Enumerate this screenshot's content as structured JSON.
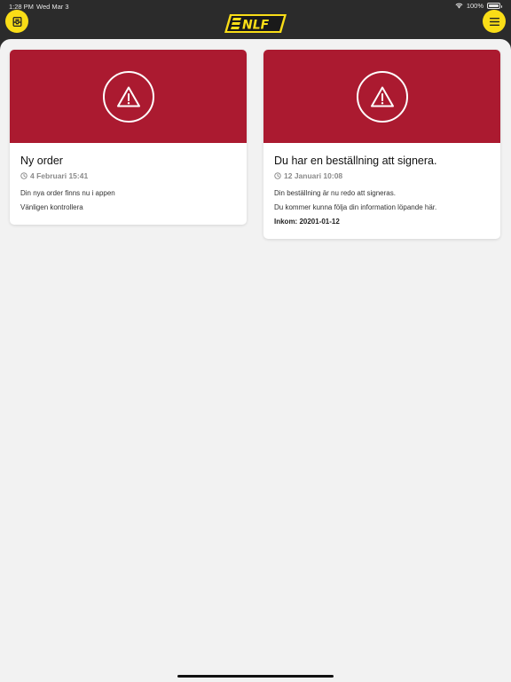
{
  "status_bar": {
    "time": "1:28 PM",
    "date": "Wed Mar 3",
    "battery": "100%"
  },
  "header": {
    "logo_text": "NLF",
    "left_icon": "inbox-icon",
    "right_icon": "menu-icon",
    "accent_color": "#f9dd17"
  },
  "notifications": [
    {
      "icon": "alert-triangle-icon",
      "banner_color": "#ab1a30",
      "title": "Ny order",
      "time": "4 Februari 15:41",
      "lines": [
        "Din nya order finns nu i appen",
        "Vänligen kontrollera"
      ]
    },
    {
      "icon": "alert-triangle-icon",
      "banner_color": "#ab1a30",
      "title": "Du har en beställning att signera.",
      "time": "12 Januari 10:08",
      "lines": [
        "Din beställning är nu redo att signeras.",
        "Du kommer kunna följa din information löpande här."
      ],
      "bold_line": "Inkom: 20201-01-12"
    }
  ]
}
